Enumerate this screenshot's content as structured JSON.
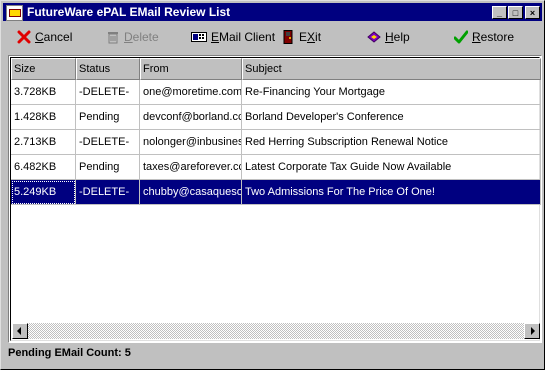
{
  "window": {
    "title": "FutureWare ePAL EMail Review List"
  },
  "titlebar_buttons": {
    "minimize": "_",
    "maximize": "□",
    "close": "×"
  },
  "toolbar": {
    "cancel": {
      "mnemonic": "C",
      "rest": "ancel",
      "icon": "red-x-icon"
    },
    "delete": {
      "mnemonic": "D",
      "rest": "elete",
      "icon": "trash-can-icon"
    },
    "email_client": {
      "prefix": "",
      "mnemonic": "E",
      "rest": "Mail Client",
      "icon": "computer-icon"
    },
    "exit": {
      "prefix": "E",
      "mnemonic": "X",
      "rest": "it",
      "icon": "door-icon"
    },
    "help": {
      "mnemonic": "H",
      "rest": "elp",
      "icon": "book-icon"
    },
    "restore": {
      "mnemonic": "R",
      "rest": "estore",
      "icon": "green-check-icon"
    }
  },
  "table": {
    "columns": [
      "Size",
      "Status",
      "From",
      "Subject"
    ],
    "rows": [
      [
        "3.728KB",
        "-DELETE-",
        "one@moretime.com",
        "Re-Financing Your Mortgage"
      ],
      [
        "1.428KB",
        "Pending",
        "devconf@borland.cc",
        "Borland Developer's Conference"
      ],
      [
        "2.713KB",
        "-DELETE-",
        "nolonger@inbusines",
        "Red Herring Subscription Renewal Notice"
      ],
      [
        "6.482KB",
        "Pending",
        "taxes@areforever.cc",
        "Latest Corporate Tax Guide Now Available"
      ],
      [
        "5.249KB",
        "-DELETE-",
        "chubby@casaqueso",
        "Two Admissions For The Price Of One!"
      ]
    ],
    "selected_row_index": 4
  },
  "status": {
    "pending_label": "Pending EMail Count:",
    "pending_count": "5"
  },
  "colors": {
    "title_bg": "#000080",
    "selection_bg": "#000080",
    "face": "#c0c0c0"
  }
}
